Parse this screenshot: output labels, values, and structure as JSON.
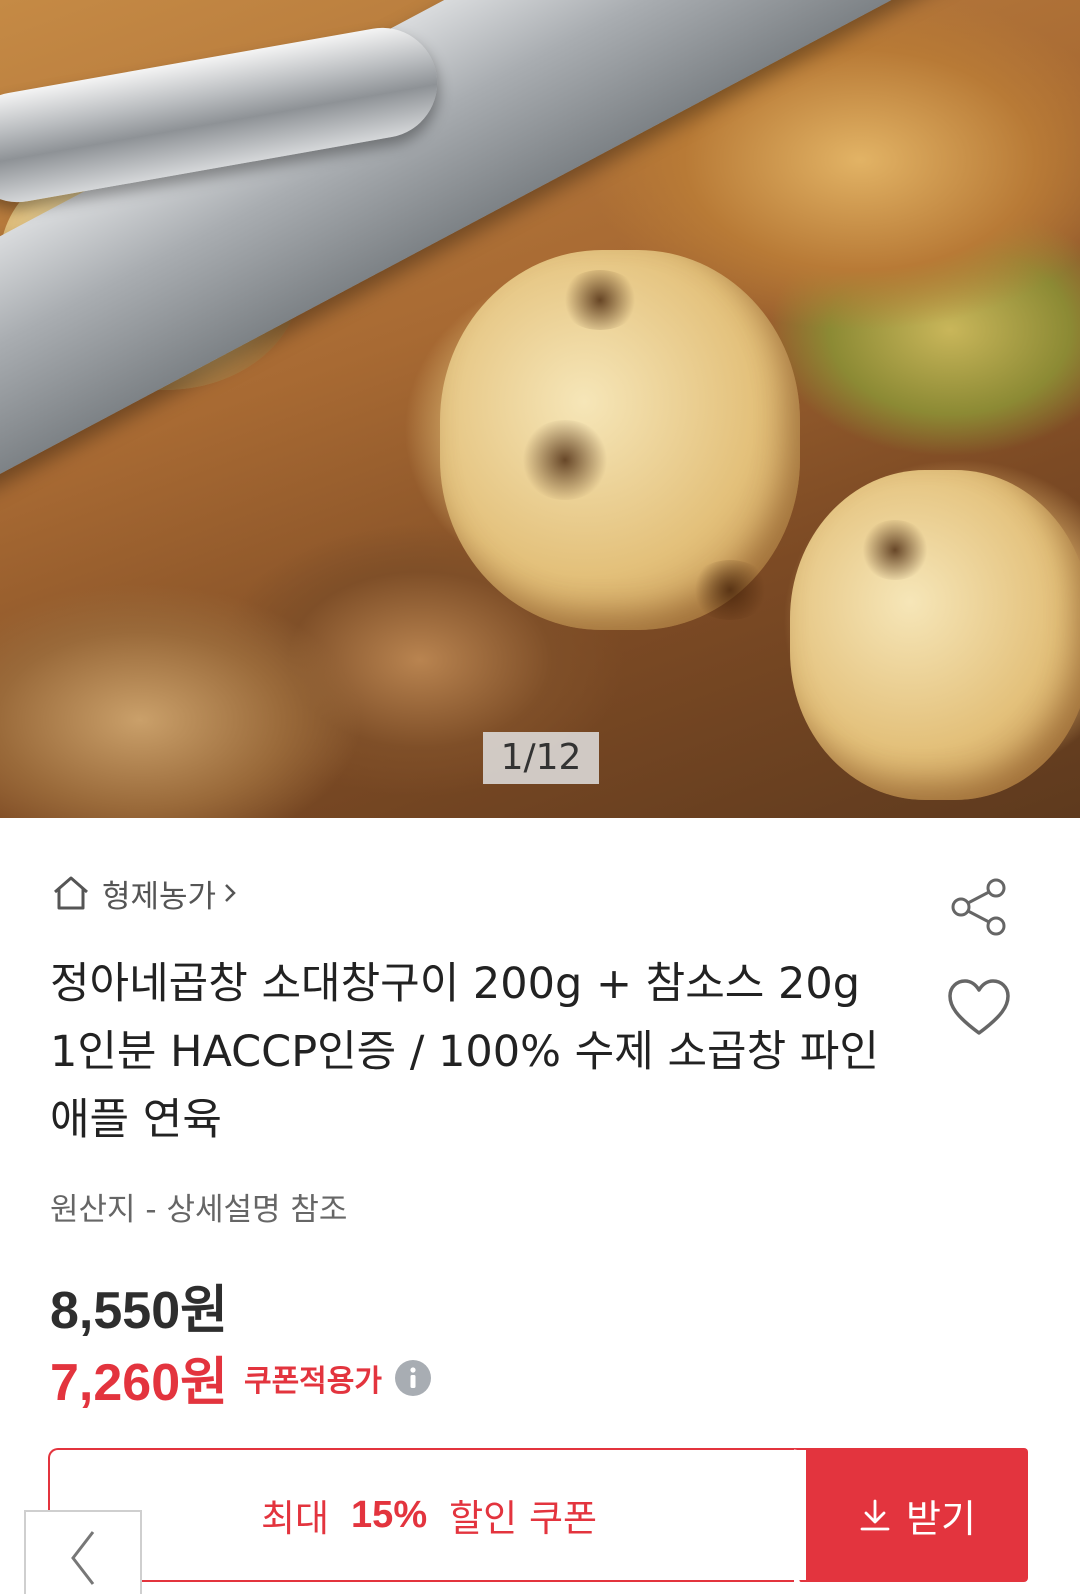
{
  "gallery": {
    "image_alt": "소대창구이",
    "counter": "1/12"
  },
  "store": {
    "name": "형제농가",
    "icon": "home-icon"
  },
  "product": {
    "title": "정아네곱창 소대창구이 200g + 참소스 20g 1인분 HACCP인증 / 100% 수제 소곱창 파인애플 연육",
    "origin": "원산지 - 상세설명 참조",
    "price": "8,550원",
    "sale_price": "7,260원",
    "sale_label": "쿠폰적용가"
  },
  "coupon": {
    "prefix": "최대",
    "percent": "15%",
    "suffix": "할인 쿠폰",
    "button_label": "받기"
  },
  "colors": {
    "accent": "#e3343e",
    "text": "#222222",
    "muted": "#666666"
  },
  "icons": [
    "home-icon",
    "chevron-right-icon",
    "share-icon",
    "heart-icon",
    "info-icon",
    "download-icon",
    "chevron-left-icon"
  ]
}
